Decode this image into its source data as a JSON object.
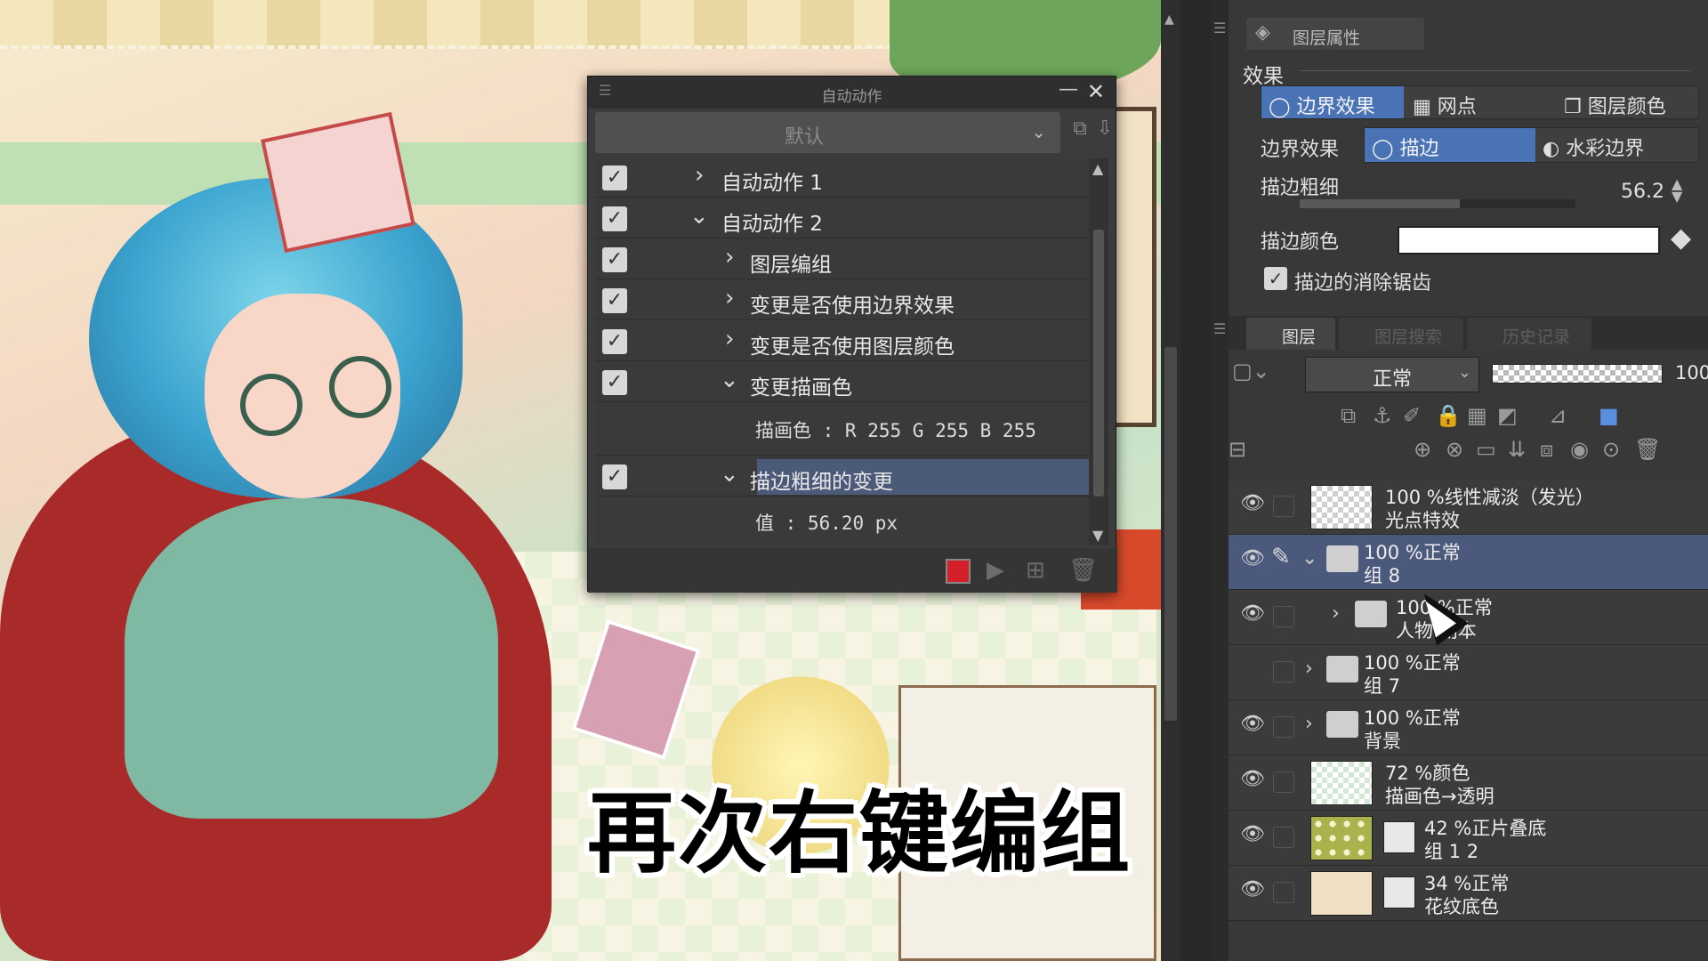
{
  "canvas": {
    "subtitle": "再次右键编组"
  },
  "auto_action": {
    "title": "自动动作",
    "set_name": "默认",
    "rows": [
      {
        "label": "自动动作 1",
        "checked": true,
        "expanded": false
      },
      {
        "label": "自动动作 2",
        "checked": true,
        "expanded": true
      },
      {
        "label": "图层编组",
        "checked": true,
        "expanded": false
      },
      {
        "label": "变更是否使用边界效果",
        "checked": true,
        "expanded": false
      },
      {
        "label": "变更是否使用图层颜色",
        "checked": true,
        "expanded": false
      },
      {
        "label": "变更描画色",
        "checked": true,
        "expanded": true
      },
      {
        "label": "描边粗细的变更",
        "checked": true,
        "expanded": true,
        "selected": true
      }
    ],
    "detail_color": "描画色 : R 255 G 255 B 255",
    "detail_value": "值 : 56.20 px",
    "record_color": "#d51f2a"
  },
  "layer_property": {
    "tab_title": "图层属性",
    "section": "效果",
    "effect_tabs": [
      "边界效果",
      "网点",
      "图层颜色"
    ],
    "border_effect_label": "边界效果",
    "border_options": [
      "描边",
      "水彩边界"
    ],
    "stroke_width_label": "描边粗细",
    "stroke_width_value": "56.2",
    "stroke_width_fraction": 0.58,
    "stroke_color_label": "描边颜色",
    "stroke_color": "#ffffff",
    "antialias_label": "描边的消除锯齿",
    "antialias_checked": true,
    "accent": "#4a73b5"
  },
  "layers_panel": {
    "tabs": [
      "图层",
      "图层搜索",
      "历史记录"
    ],
    "blend_mode": "正常",
    "opacity": "100",
    "layers": [
      {
        "line1": "100 %线性减淡（发光）",
        "line2": "光点特效",
        "visible": true,
        "kind": "raster",
        "thumb": "checker"
      },
      {
        "line1": "100 %正常",
        "line2": "组 8",
        "visible": true,
        "kind": "folder",
        "expanded": true,
        "selected": true
      },
      {
        "line1": "100 %正常",
        "line2": "人物 副本",
        "visible": true,
        "kind": "folder",
        "expanded": false,
        "nested": true
      },
      {
        "line1": "100 %正常",
        "line2": "组 7",
        "visible": false,
        "kind": "folder",
        "expanded": false
      },
      {
        "line1": "100 %正常",
        "line2": "背景",
        "visible": true,
        "kind": "folder",
        "expanded": false
      },
      {
        "line1": "72 %颜色",
        "line2": "描画色→透明",
        "visible": true,
        "kind": "raster",
        "thumb": "checker-green"
      },
      {
        "line1": "42 %正片叠底",
        "line2": "组 1 2",
        "visible": true,
        "kind": "raster",
        "thumb": "dots",
        "mask": true
      },
      {
        "line1": "34 %正常",
        "line2": "花纹底色",
        "visible": true,
        "kind": "raster",
        "thumb": "beige",
        "mask": true
      }
    ]
  },
  "icons": {
    "check": "✓",
    "chevron_right": "›",
    "chevron_down": "⌄",
    "eye": "👁",
    "close": "✕",
    "minimize": "—",
    "play": "▶",
    "trash": "🗑",
    "pen": "✎"
  }
}
